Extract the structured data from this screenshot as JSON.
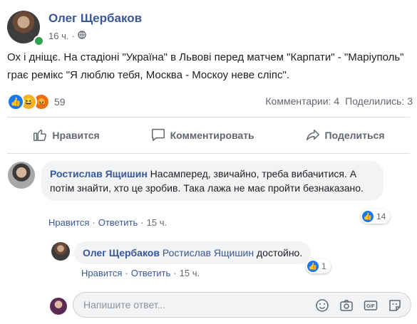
{
  "post": {
    "author": "Олег Щербаков",
    "time": "16 ч.",
    "visibility_icon": "globe-icon",
    "text": "Ох і дніщє. На стадіоні \"Україна\" в Львові перед матчем \"Карпати\" - \"Маріуполь\" грає ремікс \"Я люблю тебя, Москва - Москоу неве сліпс\".",
    "reactions": {
      "icons": [
        "like-icon",
        "haha-icon",
        "angry-icon"
      ],
      "count": "59"
    },
    "comments_label": "Комментарии: 4",
    "shares_label": "Поделились: 3"
  },
  "actions": {
    "like": "Нравится",
    "comment": "Комментировать",
    "share": "Поделиться"
  },
  "comments": [
    {
      "author": "Ростислав Ящишин",
      "text": "Насамперед, звичайно, треба вибачитися. А потім знайти, хто це зробив. Така лажа не має пройти безнаказано.",
      "like_label": "Нравится",
      "reply_label": "Ответить",
      "time": "15 ч.",
      "likes": "14"
    }
  ],
  "reply": {
    "author": "Олег Щербаков",
    "mention": "Ростислав Ящишин",
    "text": " достойно.",
    "like_label": "Нравится",
    "reply_label": "Ответить",
    "time": "15 ч.",
    "likes": "1"
  },
  "reply_input": {
    "placeholder": "Напишите ответ...",
    "icons": [
      "emoji-icon",
      "camera-icon",
      "gif-icon",
      "sticker-icon"
    ]
  },
  "colors": {
    "link": "#385898",
    "accent": "#1877f2",
    "muted": "#606770"
  }
}
